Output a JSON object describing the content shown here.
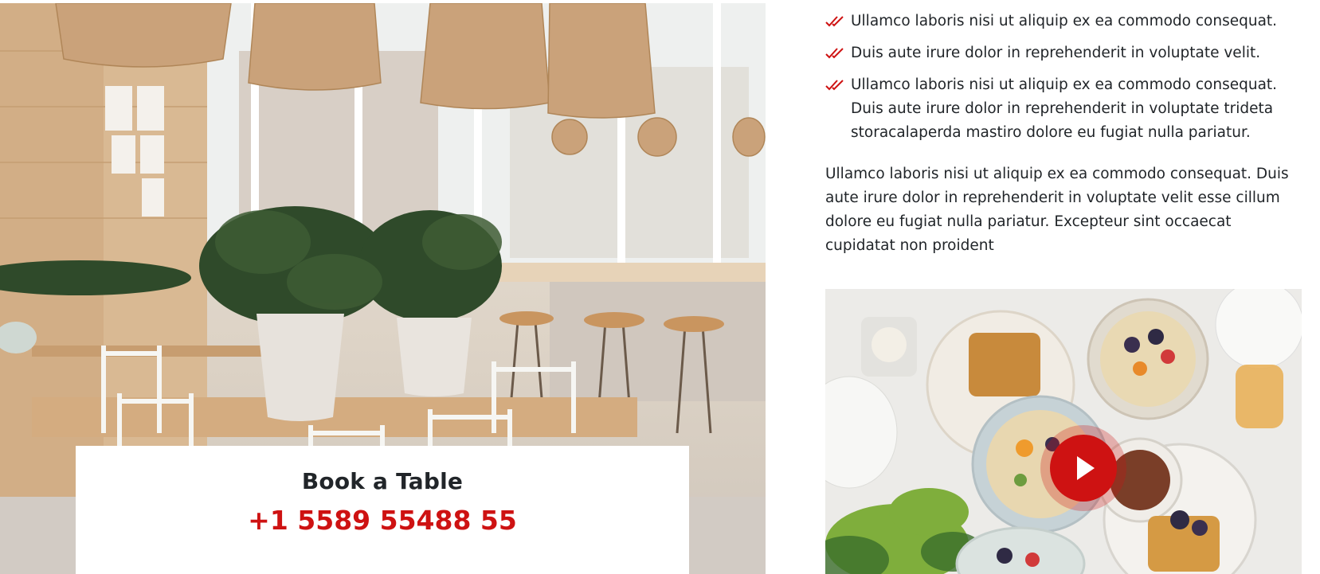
{
  "checklist": {
    "items": [
      {
        "text": "Ullamco laboris nisi ut aliquip ex ea commodo consequat."
      },
      {
        "text": "Duis aute irure dolor in reprehenderit in voluptate velit."
      },
      {
        "text": "Ullamco laboris nisi ut aliquip ex ea commodo consequat. Duis aute irure dolor in reprehenderit in voluptate trideta storacalaperda mastiro dolore eu fugiat nulla pariatur."
      }
    ],
    "icon": "double-check-icon"
  },
  "paragraph": "Ullamco laboris nisi ut aliquip ex ea commodo consequat. Duis aute irure dolor in reprehenderit in voluptate velit esse cillum dolore eu fugiat nulla pariatur. Excepteur sint occaecat cupidatat non proident",
  "book": {
    "title": "Book a Table",
    "phone": "+1 5589 55488 55"
  },
  "video": {
    "play_icon": "play-icon"
  },
  "colors": {
    "accent": "#ce1212",
    "text": "#212529"
  }
}
